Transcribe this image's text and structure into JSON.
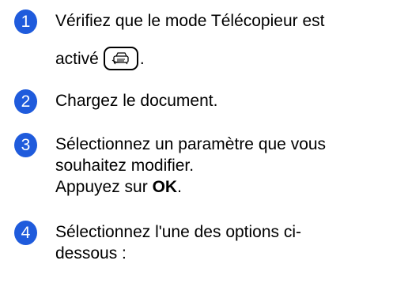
{
  "steps": [
    {
      "number": "1",
      "line1": "Vérifiez que le mode Télécopieur est",
      "line2": "activé",
      "line2_end": "."
    },
    {
      "number": "2",
      "line1": "Chargez le document."
    },
    {
      "number": "3",
      "line1": "Sélectionnez un paramètre que vous",
      "line2": "souhaitez modifier.",
      "line3_prefix": "Appuyez sur ",
      "line3_bold": "OK",
      "line3_end": "."
    },
    {
      "number": "4",
      "line1": "Sélectionnez l'une des options ci-",
      "line2": "dessous :"
    }
  ],
  "icons": {
    "fax_button": "fax-icon"
  },
  "colors": {
    "step_badge": "#1f5bdc",
    "text": "#000000"
  }
}
